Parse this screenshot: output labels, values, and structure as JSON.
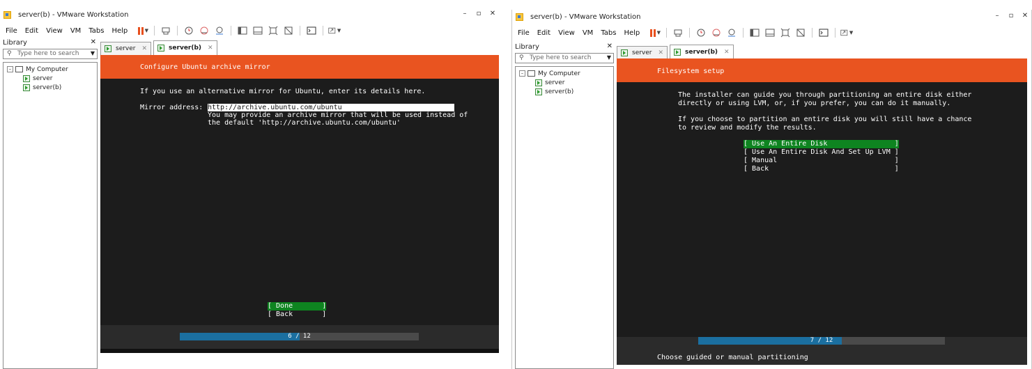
{
  "windows": [
    {
      "title": "server(b) - VMware Workstation",
      "menu": [
        "File",
        "Edit",
        "View",
        "VM",
        "Tabs",
        "Help"
      ],
      "library": {
        "label": "Library",
        "search_placeholder": "Type here to search",
        "root": "My Computer",
        "items": [
          "server",
          "server(b)"
        ]
      },
      "tabs": [
        {
          "label": "server",
          "active": false
        },
        {
          "label": "server(b)",
          "active": true
        }
      ],
      "console": {
        "header": "Configure Ubuntu archive mirror",
        "intro": "If you use an alternative mirror for Ubuntu, enter its details here.",
        "mirror_label": "Mirror address:",
        "mirror_value": "http://archive.ubuntu.com/ubuntu",
        "help_line1": "You may provide an archive mirror that will be used instead of",
        "help_line2": "the default 'http://archive.ubuntu.com/ubuntu'",
        "buttons": [
          {
            "label": "[ Done       ]",
            "selected": true
          },
          {
            "label": "[ Back       ]",
            "selected": false
          }
        ],
        "progress": {
          "text": "6 / 12",
          "fraction": 0.5
        }
      }
    },
    {
      "title": "server(b) - VMware Workstation",
      "menu": [
        "File",
        "Edit",
        "View",
        "VM",
        "Tabs",
        "Help"
      ],
      "library": {
        "label": "Library",
        "search_placeholder": "Type here to search",
        "root": "My Computer",
        "items": [
          "server",
          "server(b)"
        ]
      },
      "tabs": [
        {
          "label": "server",
          "active": false
        },
        {
          "label": "server(b)",
          "active": true
        }
      ],
      "console": {
        "header": "Filesystem setup",
        "para1_line1": "The installer can guide you through partitioning an entire disk either",
        "para1_line2": "directly or using LVM, or, if you prefer, you can do it manually.",
        "para2_line1": "If you choose to partition an entire disk you will still have a chance",
        "para2_line2": "to review and modify the results.",
        "options": [
          {
            "label": "[ Use An Entire Disk                ]",
            "selected": true
          },
          {
            "label": "[ Use An Entire Disk And Set Up LVM ]",
            "selected": false
          },
          {
            "label": "[ Manual                            ]",
            "selected": false
          },
          {
            "label": "[ Back                              ]",
            "selected": false
          }
        ],
        "progress": {
          "text": "7 / 12",
          "fraction": 0.583
        },
        "status": "Choose guided or manual partitioning"
      }
    }
  ],
  "colors": {
    "ubuntu_orange": "#e95420",
    "selected_green": "#0e8420",
    "progress_blue": "#1b6fa0",
    "pause_orange": "#e8501e"
  },
  "icons": [
    "app-icon",
    "pause-icon",
    "send-keys-icon",
    "snapshot-icon",
    "revert-icon",
    "snapshot-manager-icon",
    "library-view-icon",
    "thumbnail-icon",
    "fullscreen-icon",
    "unity-icon",
    "console-icon",
    "stretch-icon",
    "search-icon",
    "computer-icon",
    "vm-icon",
    "close-icon"
  ]
}
